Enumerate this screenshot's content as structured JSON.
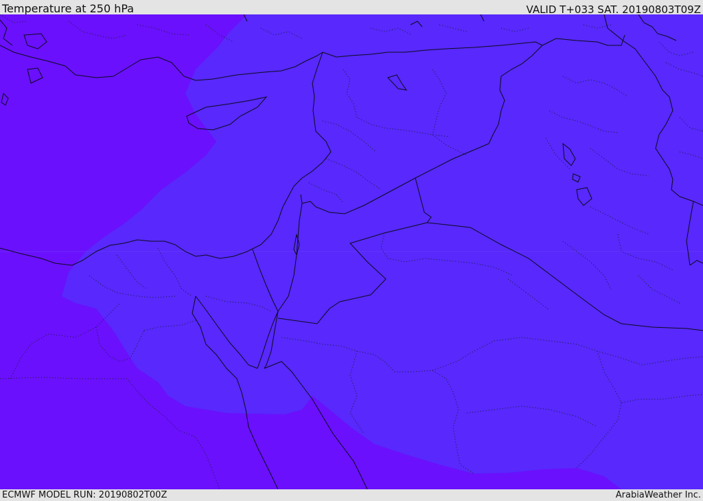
{
  "header": {
    "title": "Temperature at 250 hPa",
    "valid": "VALID T+033 SAT. 20190803T09Z"
  },
  "footer": {
    "model_run": "ECMWF MODEL RUN: 20190802T00Z",
    "credit": "ArabiaWeather Inc."
  },
  "map": {
    "field": "temperature_250hPa",
    "colors": {
      "warmer_band": "#6a10fc",
      "cooler_band": "#5828fc",
      "coastline": "#0b0b1a",
      "border": "#0b0b1a",
      "admin_boundary": "#1a1a30"
    }
  }
}
